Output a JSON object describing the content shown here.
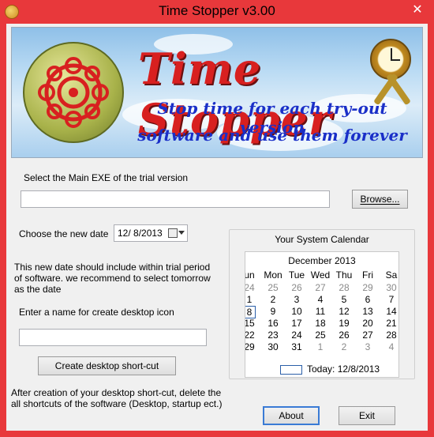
{
  "window": {
    "title": "Time Stopper v3.00",
    "close_glyph": "✕"
  },
  "banner": {
    "title": "Time Stopper",
    "line1": "Stop time for each try-out version",
    "line2": "software and use them forever"
  },
  "exe": {
    "label": "Select the Main EXE of the trial version",
    "value": "",
    "browse_label": "Browse..."
  },
  "date": {
    "label": "Choose the new date",
    "value": "12/ 8/2013"
  },
  "info_text": "This new date should include within trial period of software. we recommend to select tomorrow as the date",
  "shortcut": {
    "label": "Enter a name for create desktop icon",
    "value": "",
    "create_label": "Create desktop short-cut",
    "note": "After creation of your desktop short-cut, delete the all shortcuts of the software (Desktop, startup ect.)"
  },
  "calendar": {
    "group_label": "Your System Calendar",
    "month": "December 2013",
    "days_of_week": [
      "un",
      "Mon",
      "Tue",
      "Wed",
      "Thu",
      "Fri",
      "Sa"
    ],
    "weeks": [
      [
        "24",
        "25",
        "26",
        "27",
        "28",
        "29",
        "30"
      ],
      [
        "1",
        "2",
        "3",
        "4",
        "5",
        "6",
        "7"
      ],
      [
        "8",
        "9",
        "10",
        "11",
        "12",
        "13",
        "14"
      ],
      [
        "15",
        "16",
        "17",
        "18",
        "19",
        "20",
        "21"
      ],
      [
        "22",
        "23",
        "24",
        "25",
        "26",
        "27",
        "28"
      ],
      [
        "29",
        "30",
        "31",
        "1",
        "2",
        "3",
        "4"
      ]
    ],
    "today_label": "Today: 12/8/2013"
  },
  "footer": {
    "about_label": "About",
    "exit_label": "Exit"
  },
  "colors": {
    "titlebar": "#e8383b",
    "banner_title": "#d82020",
    "banner_sub": "#1a2fc8"
  }
}
